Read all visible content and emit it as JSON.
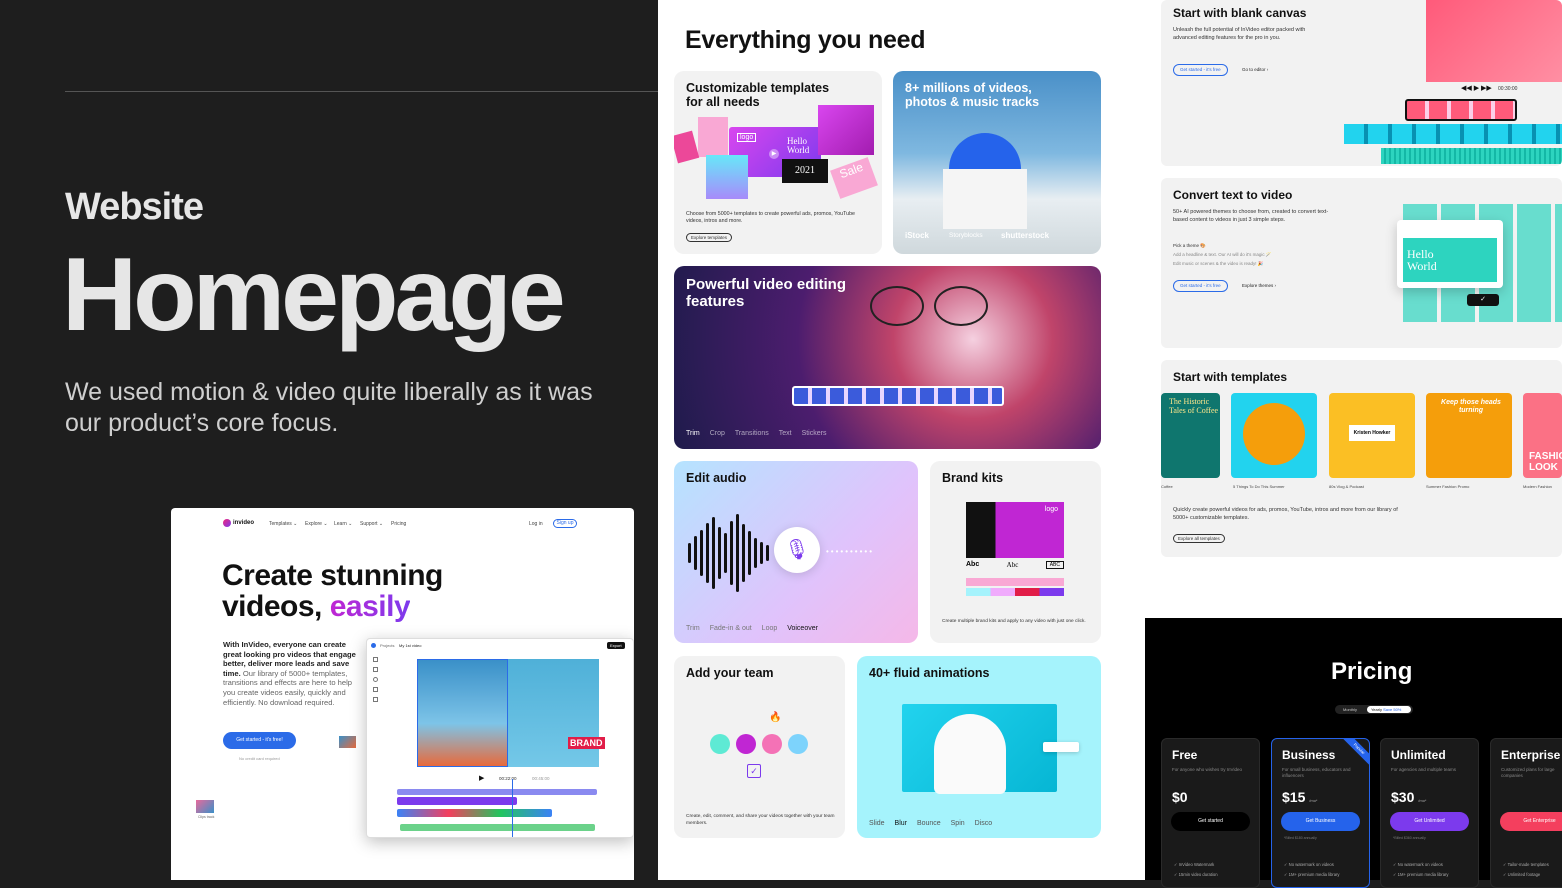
{
  "left": {
    "eyebrow": "Website",
    "title": "Homepage",
    "description": "We used motion & video quite liberally as it was our product’s core focus."
  },
  "mini": {
    "brand": "invideo",
    "nav": [
      "Templates ⌄",
      "Explore ⌄",
      "Learn ⌄",
      "Support ⌄",
      "Pricing"
    ],
    "login": "Log in",
    "signup": "Sign up",
    "title_line1": "Create stunning",
    "title_line2a": "videos, ",
    "title_line2b": "easily",
    "body_bold": "With InVideo, everyone can create great looking pro videos that engage better, deliver more leads and save time.",
    "body_rest": " Our library of 5000+ templates, transitions and effects are here to help you create videos easily, quickly and efficiently. No download required.",
    "cta": "Get started - it's free!",
    "no_card": "No credit card required",
    "editor_project": "Projects",
    "editor_file": "My 1st video",
    "editor_export": "Export",
    "editor_time": "00:22:00",
    "editor_total": "00:45:00",
    "clip_label": "Clips track",
    "brand_sign": "BRAND"
  },
  "middle": {
    "title": "Everything you need",
    "templates": {
      "title": "Customizable templates for all needs",
      "desc": "Choose from 5000+ templates to create powerful ads, promos, YouTube videos, intros and more.",
      "btn": "Explore templates",
      "logo": "logo",
      "hello": "Hello World",
      "year": "2021",
      "sale": "Sale"
    },
    "stock": {
      "title": "8+ millions of videos, photos & music tracks",
      "logos": [
        "iStock",
        "Storyblocks",
        "shutterstock"
      ]
    },
    "editing": {
      "title": "Powerful video editing features",
      "tabs": [
        "Trim",
        "Crop",
        "Transitions",
        "Text",
        "Stickers"
      ]
    },
    "audio": {
      "title": "Edit audio",
      "tabs": [
        "Trim",
        "Fade-in & out",
        "Loop",
        "Voiceover"
      ]
    },
    "brand": {
      "title": "Brand kits",
      "logo": "logo",
      "fonts": [
        "Abc",
        "Abc",
        "ABC"
      ],
      "desc": "Create multiple brand kits and apply to any video with just one click."
    },
    "team": {
      "title": "Add your team",
      "desc": "Create, edit, comment, and share your videos together with your team members."
    },
    "animations": {
      "title": "40+ fluid animations",
      "tabs": [
        "Slide",
        "Blur",
        "Bounce",
        "Spin",
        "Disco"
      ]
    }
  },
  "right": {
    "blank": {
      "title": "Start with blank canvas",
      "desc": "Unleash the full potential of InVideo editor packed with advanced editing features for the pro in you.",
      "btn": "Get started - it's free",
      "link": "Go to editor ›",
      "time": "00:30:00"
    },
    "text": {
      "title": "Convert text to video",
      "desc": "50+ AI powered themes to choose from, created to convert text-based content to videos in just 3 simple steps.",
      "step1": "Pick a theme 🎨",
      "step2": "Add a headline & text. Our AI will do it's magic 🪄",
      "step3": "Edit music or scenes & the video is ready! 🎉",
      "btn": "Get started - it's free",
      "link": "Explore themes ›",
      "hello": "Hello World"
    },
    "templates": {
      "title": "Start with templates",
      "captions": [
        "Coffee",
        "5 Things To Do This Summer",
        "80s Vlog & Podcast",
        "Summer Fashion Promo",
        "Modern Fashion"
      ],
      "t1": "The Historic Tales of Coffee",
      "t3": "Kristen Howker",
      "t4": "Keep those heads turning",
      "t5": "FASHION LOOK",
      "desc": "Quickly create powerful videos for ads, promos, YouTube, intros and more from our library of 5000+ customizable templates.",
      "btn": "Explore all templates"
    }
  },
  "pricing": {
    "title": "Pricing",
    "toggle": [
      "Monthly",
      "Yearly",
      "Save 50%"
    ],
    "plans": [
      {
        "name": "Free",
        "sub": "For anyone who wishes try InVideo",
        "price": "$0",
        "per": "",
        "btn": "Get started",
        "color": "#000000",
        "f1": "✓ InVideo Watermark",
        "f2": "✓ 15min video duration"
      },
      {
        "name": "Business",
        "sub": "For small business, educators and influencers",
        "price": "$15",
        "per": "/mo*",
        "btn": "Get Business",
        "color": "#2563eb",
        "f1": "✓ No watermark on videos",
        "f2": "✓ 1M+ premium media library"
      },
      {
        "name": "Unlimited",
        "sub": "For agencies and multiple teams",
        "price": "$30",
        "per": "/mo*",
        "btn": "Get Unlimited",
        "color": "#7c3aed",
        "f1": "✓ No watermark on videos",
        "f2": "✓ 1M+ premium media library"
      },
      {
        "name": "Enterprise",
        "sub": "Customized plans for large companies",
        "price": "",
        "per": "",
        "btn": "Get Enterprise",
        "color": "#f43f5e",
        "f1": "✓ Tailor-made templates",
        "f2": "✓ Unlimited footage"
      }
    ],
    "popular": "Popular",
    "billed_business": "*Billed $180 annually",
    "billed_unlimited": "*Billed $360 annually"
  }
}
